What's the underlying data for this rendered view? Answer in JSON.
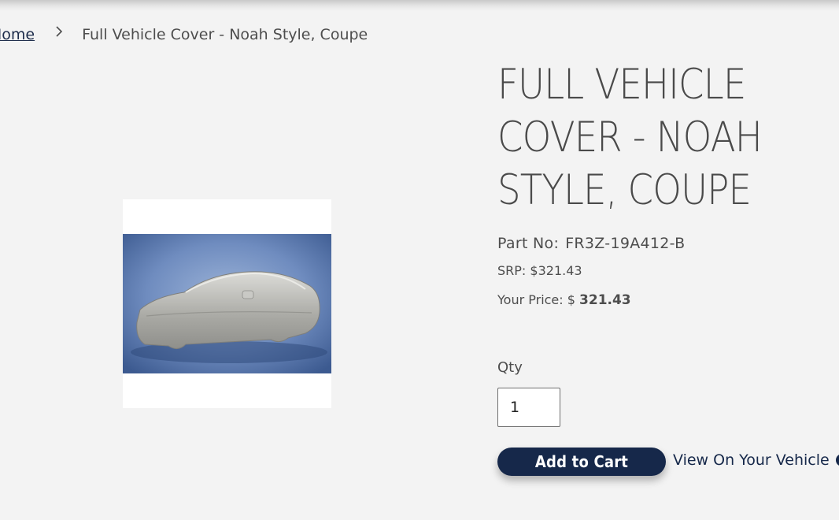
{
  "breadcrumb": {
    "home_label": "Home",
    "current_label": "Full Vehicle Cover - Noah Style, Coupe"
  },
  "product": {
    "title": "Full Vehicle Cover - Noah Style, Coupe",
    "part_no_label": "Part No:",
    "part_no_value": "FR3Z-19A412-B",
    "srp_text": "SRP: $321.43",
    "your_price_label": "Your Price: $",
    "your_price_value": "321.43"
  },
  "purchase": {
    "qty_label": "Qty",
    "qty_value": "1",
    "add_to_cart_label": "Add to Cart",
    "view_on_vehicle_label": "View On Your Vehicle"
  },
  "icons": {
    "breadcrumb_separator": "chevron-right-icon",
    "view_link_arrow": "arrow-circle-right-icon"
  },
  "colors": {
    "brand_navy": "#16284a",
    "page_background": "#f3f3f3",
    "text_gray": "#4d4d4d"
  }
}
